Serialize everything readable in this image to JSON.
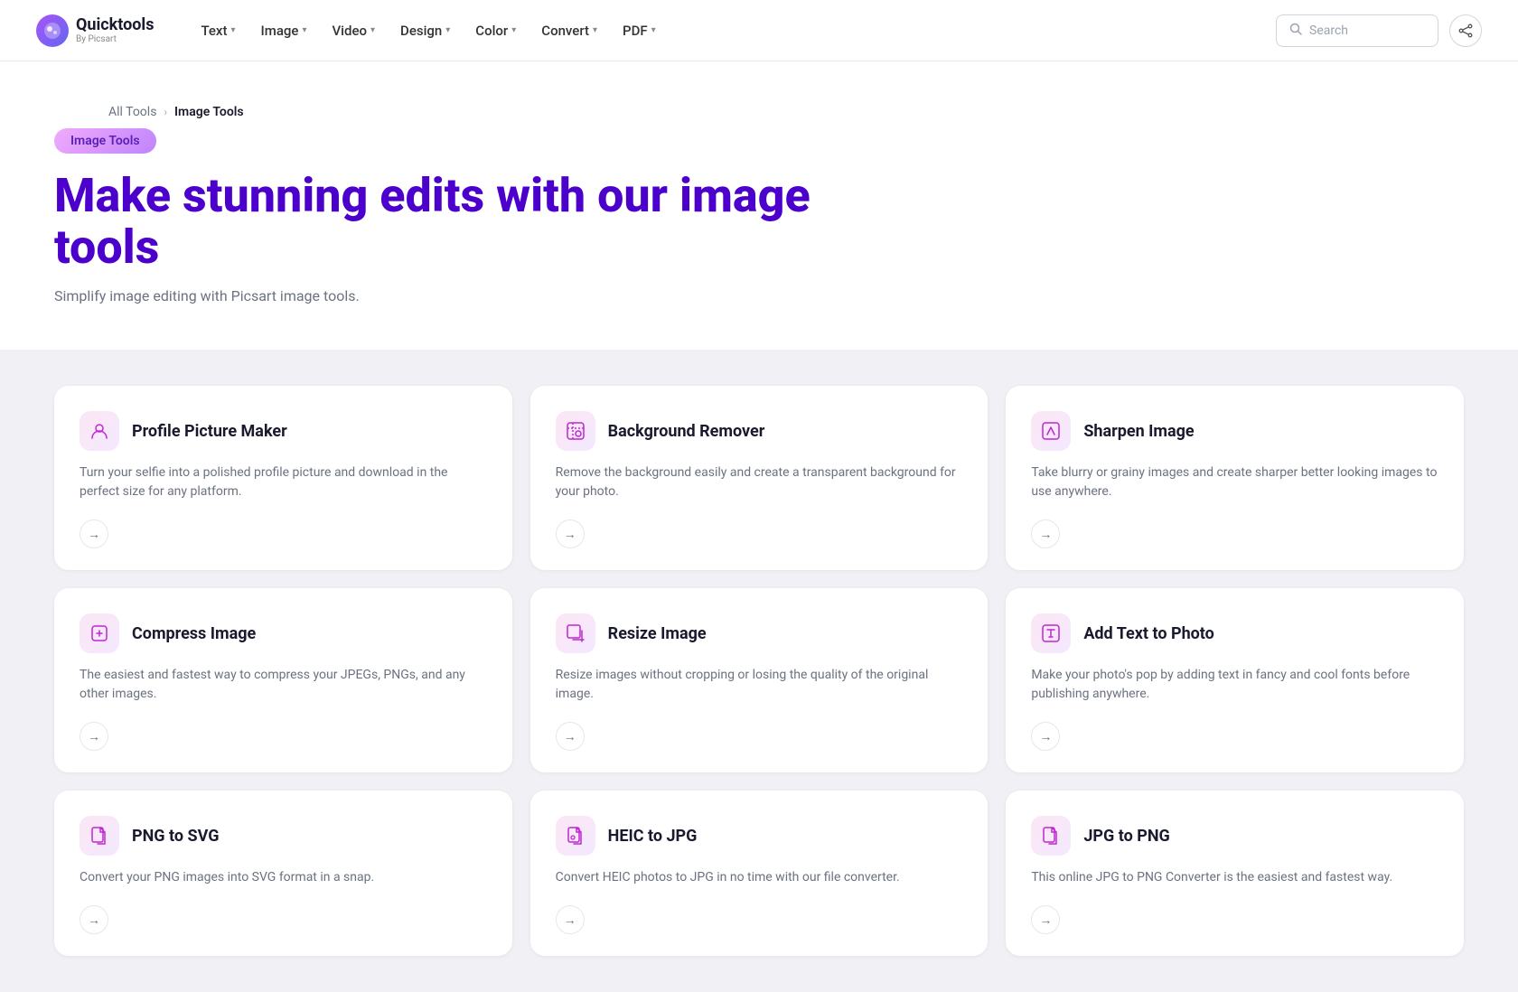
{
  "logo": {
    "icon": "Q",
    "main": "Quicktools",
    "sub": "By Picsart"
  },
  "nav": {
    "items": [
      {
        "label": "Text",
        "id": "text"
      },
      {
        "label": "Image",
        "id": "image"
      },
      {
        "label": "Video",
        "id": "video"
      },
      {
        "label": "Design",
        "id": "design"
      },
      {
        "label": "Color",
        "id": "color"
      },
      {
        "label": "Convert",
        "id": "convert"
      },
      {
        "label": "PDF",
        "id": "pdf"
      }
    ]
  },
  "search": {
    "placeholder": "Search"
  },
  "breadcrumb": {
    "all_tools": "All Tools",
    "current": "Image Tools"
  },
  "hero": {
    "badge": "Image Tools",
    "title": "Make stunning edits with our image tools",
    "subtitle": "Simplify image editing with Picsart image tools."
  },
  "tools": [
    {
      "id": "profile-picture-maker",
      "icon": "😊",
      "name": "Profile Picture Maker",
      "desc": "Turn your selfie into a polished profile picture and download in the perfect size for any platform."
    },
    {
      "id": "background-remover",
      "icon": "🖼",
      "name": "Background Remover",
      "desc": "Remove the background easily and create a transparent background for your photo."
    },
    {
      "id": "sharpen-image",
      "icon": "✨",
      "name": "Sharpen Image",
      "desc": "Take blurry or grainy images and create sharper better looking images to use anywhere."
    },
    {
      "id": "compress-image",
      "icon": "📦",
      "name": "Compress Image",
      "desc": "The easiest and fastest way to compress your JPEGs, PNGs, and any other images."
    },
    {
      "id": "resize-image",
      "icon": "📐",
      "name": "Resize Image",
      "desc": "Resize images without cropping or losing the quality of the original image."
    },
    {
      "id": "add-text-to-photo",
      "icon": "🔤",
      "name": "Add Text to Photo",
      "desc": "Make your photo's pop by adding text in fancy and cool fonts before publishing anywhere."
    },
    {
      "id": "png-to-svg",
      "icon": "📄",
      "name": "PNG to SVG",
      "desc": "Convert your PNG images into SVG format in a snap."
    },
    {
      "id": "heic-to-jpg",
      "icon": "📷",
      "name": "HEIC to JPG",
      "desc": "Convert HEIC photos to JPG in no time with our file converter."
    },
    {
      "id": "jpg-to-png",
      "icon": "🖼",
      "name": "JPG to PNG",
      "desc": "This online JPG to PNG Converter is the easiest and fastest way."
    }
  ]
}
